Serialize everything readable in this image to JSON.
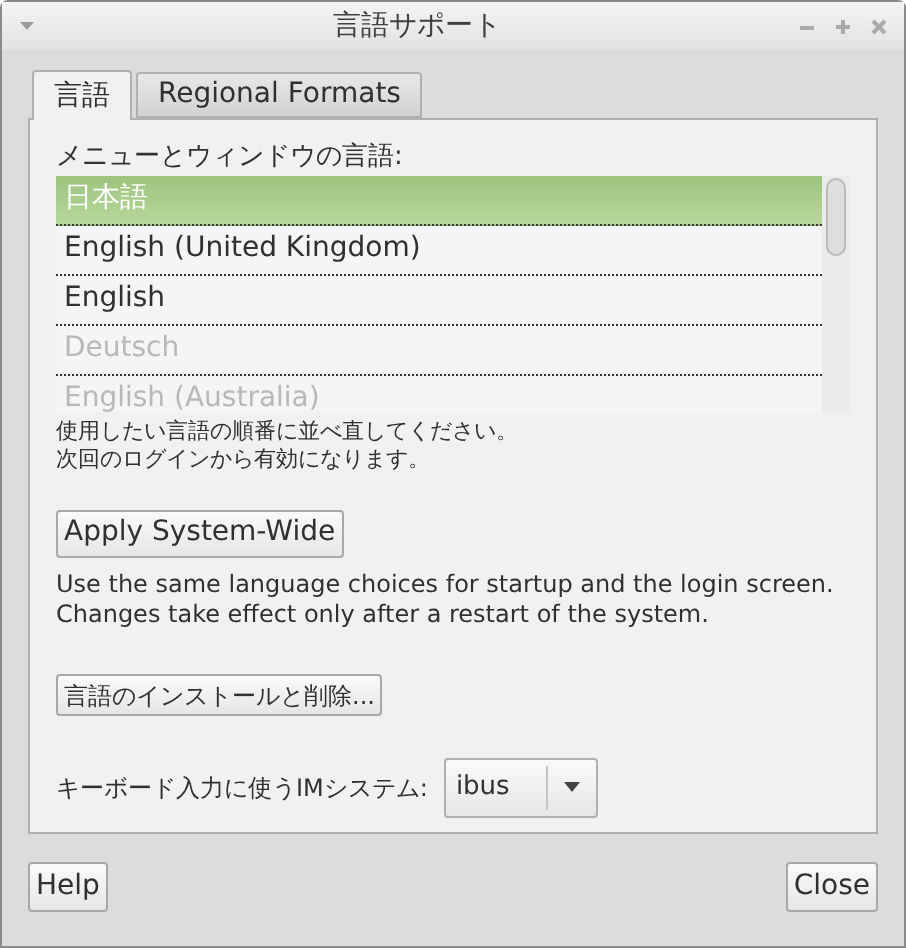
{
  "window": {
    "title": "言語サポート"
  },
  "tabs": [
    {
      "label": "言語",
      "selected": true
    },
    {
      "label": "Regional Formats",
      "selected": false
    }
  ],
  "languages": {
    "label": "メニューとウィンドウの言語:",
    "items": [
      {
        "name": "日本語",
        "selected": true,
        "disabled": false
      },
      {
        "name": "English (United Kingdom)",
        "selected": false,
        "disabled": false
      },
      {
        "name": "English",
        "selected": false,
        "disabled": false
      },
      {
        "name": "Deutsch",
        "selected": false,
        "disabled": true
      },
      {
        "name": "English (Australia)",
        "selected": false,
        "disabled": true
      }
    ]
  },
  "hint": [
    "使用したい言語の順番に並べ直してください。",
    "次回のログインから有効になります。"
  ],
  "apply_button": "Apply System-Wide",
  "apply_note": [
    "Use the same language choices for startup and the login screen.",
    "Changes take effect only after a restart of the system."
  ],
  "install_button": "言語のインストールと削除...",
  "im": {
    "label": "キーボード入力に使うIMシステム:",
    "value": "ibus"
  },
  "buttons": {
    "help": "Help",
    "close": "Close"
  }
}
